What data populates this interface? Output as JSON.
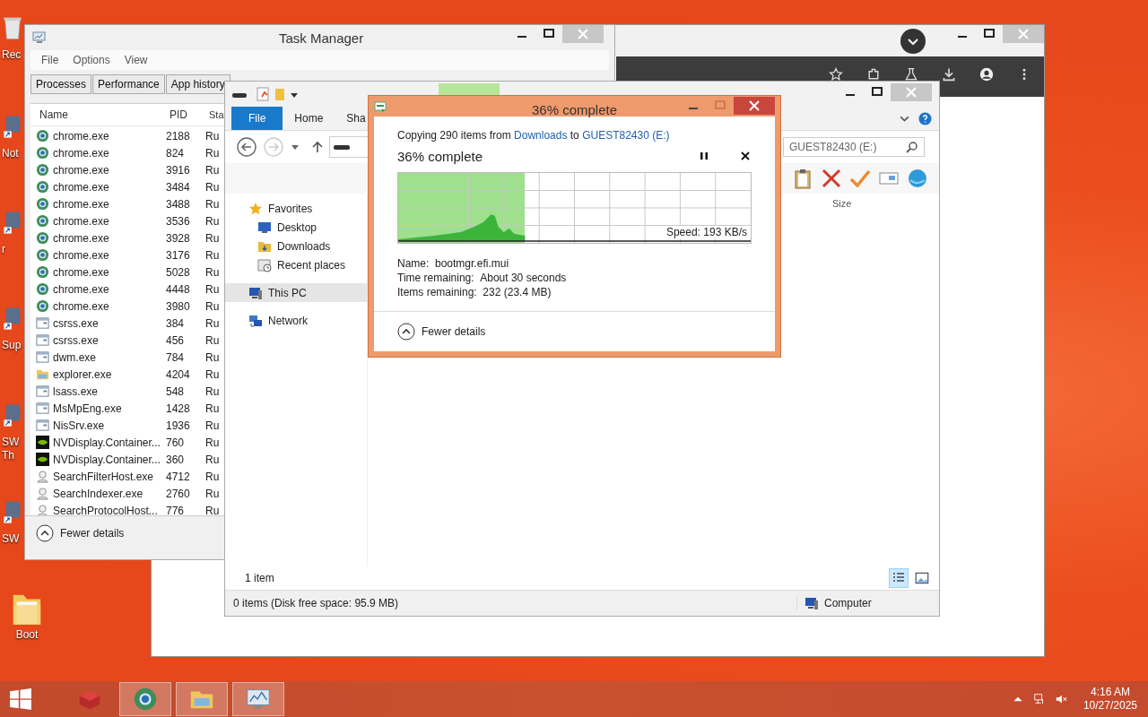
{
  "desktop_icons": [
    {
      "label": "Rec",
      "kind": "bin"
    },
    {
      "label": "Not",
      "kind": "app"
    },
    {
      "label": "r",
      "kind": "app"
    },
    {
      "label": "Sup",
      "kind": "app"
    },
    {
      "label": "SW Th",
      "kind": "app"
    },
    {
      "label": "SW",
      "kind": "app"
    },
    {
      "label": "Boot",
      "kind": "folder"
    }
  ],
  "task_manager": {
    "title": "Task Manager",
    "menu": [
      "File",
      "Options",
      "View"
    ],
    "tabs": [
      {
        "label": "Processes",
        "selected": false
      },
      {
        "label": "Performance",
        "selected": false
      },
      {
        "label": "App history",
        "selected": false
      }
    ],
    "columns": [
      "Name",
      "PID",
      "Sta"
    ],
    "rows": [
      {
        "name": "chrome.exe",
        "pid": "2188",
        "status": "Ru",
        "kind": "chrome"
      },
      {
        "name": "chrome.exe",
        "pid": "824",
        "status": "Ru",
        "kind": "chrome"
      },
      {
        "name": "chrome.exe",
        "pid": "3916",
        "status": "Ru",
        "kind": "chrome"
      },
      {
        "name": "chrome.exe",
        "pid": "3484",
        "status": "Ru",
        "kind": "chrome"
      },
      {
        "name": "chrome.exe",
        "pid": "3488",
        "status": "Ru",
        "kind": "chrome"
      },
      {
        "name": "chrome.exe",
        "pid": "3536",
        "status": "Ru",
        "kind": "chrome"
      },
      {
        "name": "chrome.exe",
        "pid": "3928",
        "status": "Ru",
        "kind": "chrome"
      },
      {
        "name": "chrome.exe",
        "pid": "3176",
        "status": "Ru",
        "kind": "chrome"
      },
      {
        "name": "chrome.exe",
        "pid": "5028",
        "status": "Ru",
        "kind": "chrome"
      },
      {
        "name": "chrome.exe",
        "pid": "4448",
        "status": "Ru",
        "kind": "chrome"
      },
      {
        "name": "chrome.exe",
        "pid": "3980",
        "status": "Ru",
        "kind": "chrome"
      },
      {
        "name": "csrss.exe",
        "pid": "384",
        "status": "Ru",
        "kind": "app"
      },
      {
        "name": "csrss.exe",
        "pid": "456",
        "status": "Ru",
        "kind": "app"
      },
      {
        "name": "dwm.exe",
        "pid": "784",
        "status": "Ru",
        "kind": "app"
      },
      {
        "name": "explorer.exe",
        "pid": "4204",
        "status": "Ru",
        "kind": "folder"
      },
      {
        "name": "lsass.exe",
        "pid": "548",
        "status": "Ru",
        "kind": "app"
      },
      {
        "name": "MsMpEng.exe",
        "pid": "1428",
        "status": "Ru",
        "kind": "app"
      },
      {
        "name": "NisSrv.exe",
        "pid": "1936",
        "status": "Ru",
        "kind": "app"
      },
      {
        "name": "NVDisplay.Container...",
        "pid": "760",
        "status": "Ru",
        "kind": "gpu"
      },
      {
        "name": "NVDisplay.Container...",
        "pid": "360",
        "status": "Ru",
        "kind": "gpu"
      },
      {
        "name": "SearchFilterHost.exe",
        "pid": "4712",
        "status": "Ru",
        "kind": "search"
      },
      {
        "name": "SearchIndexer.exe",
        "pid": "2760",
        "status": "Ru",
        "kind": "search"
      },
      {
        "name": "SearchProtocolHost...",
        "pid": "776",
        "status": "Ru",
        "kind": "search"
      }
    ],
    "footer": "Fewer details"
  },
  "explorer": {
    "ribbon_tabs": [
      {
        "label": "File",
        "selected": true
      },
      {
        "label": "Home",
        "selected": false
      },
      {
        "label": "Sha",
        "selected": false
      }
    ],
    "search": {
      "value": "GUEST82430 (E:)"
    },
    "nav": [
      {
        "label": "Favorites",
        "kind": "star",
        "selected": false,
        "children": [
          {
            "label": "Desktop",
            "kind": "desktop",
            "selected": false
          },
          {
            "label": "Downloads",
            "kind": "folder",
            "selected": false
          },
          {
            "label": "Recent places",
            "kind": "recent",
            "selected": false
          }
        ]
      },
      {
        "label": "This PC",
        "kind": "pc",
        "selected": true
      },
      {
        "label": "Network",
        "kind": "network",
        "selected": false
      }
    ],
    "column": "Size",
    "item_count": "1 item",
    "status": "0 items (Disk free space: 95.9 MB)",
    "location": "Computer"
  },
  "copy_dialog": {
    "title": "36% complete",
    "prefix": "Copying 290 items from",
    "source": "Downloads",
    "middle": "to",
    "destination": "GUEST82430 (E:)",
    "heading": "36% complete",
    "level": 0.36,
    "speed": "Speed: 193 KB/s",
    "details": [
      {
        "label": "Name:",
        "value": "bootmgr.efi.mui"
      },
      {
        "label": "Time remaining:",
        "value": "About 30 seconds"
      },
      {
        "label": "Items remaining:",
        "value": "232 (23.4 MB)"
      }
    ],
    "toggle": "Fewer details"
  },
  "taskbar": {
    "apps": [
      {
        "kind": "box",
        "selected": false
      },
      {
        "kind": "chrome",
        "selected": true
      },
      {
        "kind": "folder",
        "selected": true
      },
      {
        "kind": "monitor",
        "selected": true
      }
    ],
    "time": "4:16 AM",
    "date": "10/27/2025"
  }
}
